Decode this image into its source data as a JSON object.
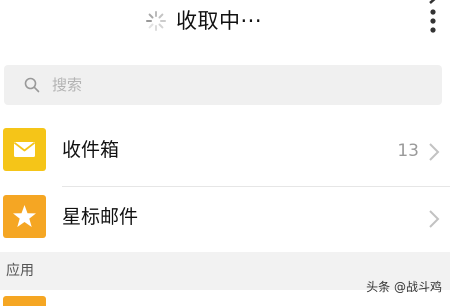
{
  "header": {
    "title": "收取中···",
    "spinner_icon": "loading-spinner-icon",
    "more_icon": "more-vertical-icon"
  },
  "search": {
    "placeholder": "搜索",
    "icon": "search-icon"
  },
  "mail_rows": [
    {
      "label": "收件箱",
      "count": "13",
      "icon": "envelope-icon",
      "icon_bg": "#f5c518"
    },
    {
      "label": "星标邮件",
      "count": "",
      "icon": "star-icon",
      "icon_bg": "#f5a623"
    }
  ],
  "section": {
    "title": "应用"
  },
  "partial_row": {
    "icon_bg": "#f5a623"
  },
  "watermark": {
    "text": "头条 @战斗鸡"
  },
  "colors": {
    "background": "#ffffff",
    "search_bg": "#f0f0f0",
    "section_bg": "#f2f2f2",
    "inbox_tile": "#f5c518",
    "star_tile": "#f5a623"
  }
}
